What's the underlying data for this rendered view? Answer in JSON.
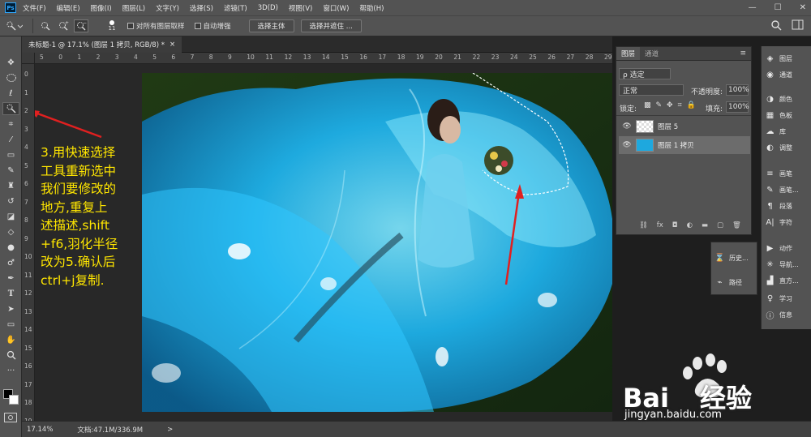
{
  "menu": {
    "logo": "Ps",
    "items": [
      "文件(F)",
      "编辑(E)",
      "图像(I)",
      "图层(L)",
      "文字(Y)",
      "选择(S)",
      "滤镜(T)",
      "3D(D)",
      "视图(V)",
      "窗口(W)",
      "帮助(H)"
    ],
    "minimize": "—",
    "maximize": "☐",
    "close": "✕"
  },
  "options": {
    "brush_size": "11",
    "sample_all_layers": "对所有图层取样",
    "auto_enhance": "自动增强",
    "select_subject": "选择主体",
    "select_and_mask": "选择并遮住 ..."
  },
  "document": {
    "tab_title": "未标题-1 @ 17.1% (图层 1 拷贝, RGB/8) *",
    "tab_close": "×"
  },
  "rulers": {
    "top": [
      "5",
      "0",
      "1",
      "2",
      "3",
      "4",
      "5",
      "6",
      "7",
      "8",
      "9",
      "10",
      "11",
      "12",
      "13",
      "14",
      "15",
      "16",
      "17",
      "18",
      "19",
      "20",
      "21",
      "22",
      "23",
      "24",
      "25",
      "26",
      "27",
      "28",
      "29"
    ],
    "left": [
      "0",
      "1",
      "2",
      "3",
      "4",
      "5",
      "6",
      "7",
      "8",
      "9",
      "10",
      "11",
      "12",
      "13",
      "14",
      "15",
      "16",
      "17",
      "18",
      "19"
    ]
  },
  "annotation": {
    "lines": [
      "3.用快速选择",
      "工具重新选中",
      "我们要修改的",
      "地方,重复上",
      "述描述,shift",
      "+f6,羽化半径",
      "改为5.确认后",
      "ctrl+j复制."
    ]
  },
  "status": {
    "zoom": "17.14%",
    "doc_size": "文档:47.1M/336.9M",
    "arrow": ">"
  },
  "layers_panel": {
    "tab_layers": "图层",
    "tab_channels": "通道",
    "filter_kind": "ρ 选定",
    "blend_mode": "正常",
    "opacity_label": "不透明度:",
    "opacity_value": "100%",
    "lock_label": "锁定:",
    "fill_label": "填充:",
    "fill_value": "100%",
    "layers": [
      {
        "name": "图层 5",
        "selected": false
      },
      {
        "name": "图层 1 拷贝",
        "selected": true
      }
    ],
    "footer_icons": [
      "link-icon",
      "fx-icon",
      "mask-icon",
      "adjustment-icon",
      "folder-icon",
      "new-layer-icon",
      "trash-icon"
    ],
    "footer_labels": [
      "⛓",
      "fx",
      "◘",
      "◐",
      "▬",
      "▢",
      "🗑"
    ]
  },
  "history_panel": {
    "history": "历史...",
    "paths": "路径"
  },
  "right_rail": {
    "items": [
      {
        "icon": "layers-icon",
        "glyph": "◈",
        "label": "图层"
      },
      {
        "icon": "channels-icon",
        "glyph": "◉",
        "label": "通道"
      },
      {
        "icon": "color-icon",
        "glyph": "◑",
        "label": "颜色"
      },
      {
        "icon": "swatches-icon",
        "glyph": "▦",
        "label": "色板"
      },
      {
        "icon": "libraries-icon",
        "glyph": "☁",
        "label": "库"
      },
      {
        "icon": "adjustments-icon",
        "glyph": "◐",
        "label": "调整"
      },
      {
        "icon": "brush-icon",
        "glyph": "≡",
        "label": "画笔"
      },
      {
        "icon": "brush-settings-icon",
        "glyph": "✎",
        "label": "画笔..."
      },
      {
        "icon": "paragraph-icon",
        "glyph": "¶",
        "label": "段落"
      },
      {
        "icon": "character-icon",
        "glyph": "A|",
        "label": "字符"
      },
      {
        "icon": "actions-icon",
        "glyph": "▶",
        "label": "动作"
      },
      {
        "icon": "navigator-icon",
        "glyph": "✳",
        "label": "导航..."
      },
      {
        "icon": "histogram-icon",
        "glyph": "▟",
        "label": "直方..."
      },
      {
        "icon": "learn-icon",
        "glyph": "♀",
        "label": "学习"
      },
      {
        "icon": "info-icon",
        "glyph": "ⓘ",
        "label": "信息"
      }
    ]
  },
  "watermark": {
    "brand_a": "Bai",
    "brand_b": "经验",
    "url": "jingyan.baidu.com"
  },
  "colors": {
    "annotation": "#ffe600",
    "arrow": "#e02020",
    "ui_bg": "#535353",
    "dress": "#1ec8ff"
  }
}
